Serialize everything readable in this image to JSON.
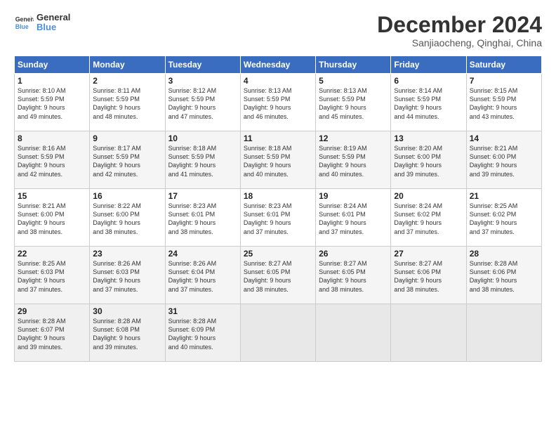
{
  "header": {
    "logo": {
      "line1": "General",
      "line2": "Blue"
    },
    "title": "December 2024",
    "subtitle": "Sanjiaocheng, Qinghai, China"
  },
  "weekdays": [
    "Sunday",
    "Monday",
    "Tuesday",
    "Wednesday",
    "Thursday",
    "Friday",
    "Saturday"
  ],
  "weeks": [
    [
      {
        "day": "1",
        "info": "Sunrise: 8:10 AM\nSunset: 5:59 PM\nDaylight: 9 hours\nand 49 minutes."
      },
      {
        "day": "2",
        "info": "Sunrise: 8:11 AM\nSunset: 5:59 PM\nDaylight: 9 hours\nand 48 minutes."
      },
      {
        "day": "3",
        "info": "Sunrise: 8:12 AM\nSunset: 5:59 PM\nDaylight: 9 hours\nand 47 minutes."
      },
      {
        "day": "4",
        "info": "Sunrise: 8:13 AM\nSunset: 5:59 PM\nDaylight: 9 hours\nand 46 minutes."
      },
      {
        "day": "5",
        "info": "Sunrise: 8:13 AM\nSunset: 5:59 PM\nDaylight: 9 hours\nand 45 minutes."
      },
      {
        "day": "6",
        "info": "Sunrise: 8:14 AM\nSunset: 5:59 PM\nDaylight: 9 hours\nand 44 minutes."
      },
      {
        "day": "7",
        "info": "Sunrise: 8:15 AM\nSunset: 5:59 PM\nDaylight: 9 hours\nand 43 minutes."
      }
    ],
    [
      {
        "day": "8",
        "info": "Sunrise: 8:16 AM\nSunset: 5:59 PM\nDaylight: 9 hours\nand 42 minutes."
      },
      {
        "day": "9",
        "info": "Sunrise: 8:17 AM\nSunset: 5:59 PM\nDaylight: 9 hours\nand 42 minutes."
      },
      {
        "day": "10",
        "info": "Sunrise: 8:18 AM\nSunset: 5:59 PM\nDaylight: 9 hours\nand 41 minutes."
      },
      {
        "day": "11",
        "info": "Sunrise: 8:18 AM\nSunset: 5:59 PM\nDaylight: 9 hours\nand 40 minutes."
      },
      {
        "day": "12",
        "info": "Sunrise: 8:19 AM\nSunset: 5:59 PM\nDaylight: 9 hours\nand 40 minutes."
      },
      {
        "day": "13",
        "info": "Sunrise: 8:20 AM\nSunset: 6:00 PM\nDaylight: 9 hours\nand 39 minutes."
      },
      {
        "day": "14",
        "info": "Sunrise: 8:21 AM\nSunset: 6:00 PM\nDaylight: 9 hours\nand 39 minutes."
      }
    ],
    [
      {
        "day": "15",
        "info": "Sunrise: 8:21 AM\nSunset: 6:00 PM\nDaylight: 9 hours\nand 38 minutes."
      },
      {
        "day": "16",
        "info": "Sunrise: 8:22 AM\nSunset: 6:00 PM\nDaylight: 9 hours\nand 38 minutes."
      },
      {
        "day": "17",
        "info": "Sunrise: 8:23 AM\nSunset: 6:01 PM\nDaylight: 9 hours\nand 38 minutes."
      },
      {
        "day": "18",
        "info": "Sunrise: 8:23 AM\nSunset: 6:01 PM\nDaylight: 9 hours\nand 37 minutes."
      },
      {
        "day": "19",
        "info": "Sunrise: 8:24 AM\nSunset: 6:01 PM\nDaylight: 9 hours\nand 37 minutes."
      },
      {
        "day": "20",
        "info": "Sunrise: 8:24 AM\nSunset: 6:02 PM\nDaylight: 9 hours\nand 37 minutes."
      },
      {
        "day": "21",
        "info": "Sunrise: 8:25 AM\nSunset: 6:02 PM\nDaylight: 9 hours\nand 37 minutes."
      }
    ],
    [
      {
        "day": "22",
        "info": "Sunrise: 8:25 AM\nSunset: 6:03 PM\nDaylight: 9 hours\nand 37 minutes."
      },
      {
        "day": "23",
        "info": "Sunrise: 8:26 AM\nSunset: 6:03 PM\nDaylight: 9 hours\nand 37 minutes."
      },
      {
        "day": "24",
        "info": "Sunrise: 8:26 AM\nSunset: 6:04 PM\nDaylight: 9 hours\nand 37 minutes."
      },
      {
        "day": "25",
        "info": "Sunrise: 8:27 AM\nSunset: 6:05 PM\nDaylight: 9 hours\nand 38 minutes."
      },
      {
        "day": "26",
        "info": "Sunrise: 8:27 AM\nSunset: 6:05 PM\nDaylight: 9 hours\nand 38 minutes."
      },
      {
        "day": "27",
        "info": "Sunrise: 8:27 AM\nSunset: 6:06 PM\nDaylight: 9 hours\nand 38 minutes."
      },
      {
        "day": "28",
        "info": "Sunrise: 8:28 AM\nSunset: 6:06 PM\nDaylight: 9 hours\nand 38 minutes."
      }
    ],
    [
      {
        "day": "29",
        "info": "Sunrise: 8:28 AM\nSunset: 6:07 PM\nDaylight: 9 hours\nand 39 minutes."
      },
      {
        "day": "30",
        "info": "Sunrise: 8:28 AM\nSunset: 6:08 PM\nDaylight: 9 hours\nand 39 minutes."
      },
      {
        "day": "31",
        "info": "Sunrise: 8:28 AM\nSunset: 6:09 PM\nDaylight: 9 hours\nand 40 minutes."
      },
      {
        "day": "",
        "info": ""
      },
      {
        "day": "",
        "info": ""
      },
      {
        "day": "",
        "info": ""
      },
      {
        "day": "",
        "info": ""
      }
    ]
  ]
}
